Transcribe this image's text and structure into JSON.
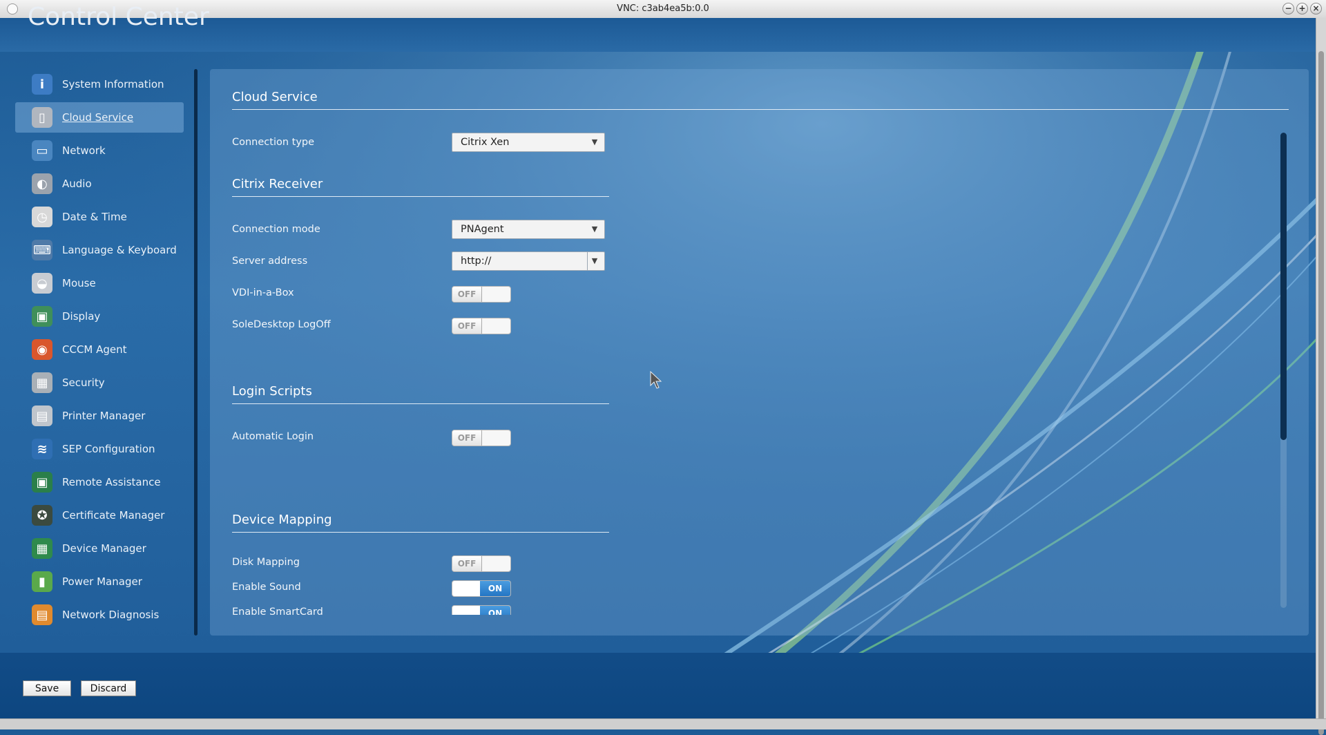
{
  "window": {
    "title": "VNC: c3ab4ea5b:0.0",
    "controls": [
      "minimize-icon",
      "maximize-icon",
      "close-icon"
    ]
  },
  "app": {
    "title": "Control Center"
  },
  "sidebar": {
    "items": [
      {
        "label": "System Information",
        "icon": "info-icon",
        "active": false
      },
      {
        "label": "Cloud Service",
        "icon": "cloud-service-icon",
        "active": true
      },
      {
        "label": "Network",
        "icon": "network-icon",
        "active": false
      },
      {
        "label": "Audio",
        "icon": "speaker-icon",
        "active": false
      },
      {
        "label": "Date & Time",
        "icon": "clock-icon",
        "active": false
      },
      {
        "label": "Language & Keyboard",
        "icon": "keyboard-icon",
        "active": false
      },
      {
        "label": "Mouse",
        "icon": "mouse-icon",
        "active": false
      },
      {
        "label": "Display",
        "icon": "monitor-icon",
        "active": false
      },
      {
        "label": "CCCM Agent",
        "icon": "cccm-agent-icon",
        "active": false
      },
      {
        "label": "Security",
        "icon": "security-icon",
        "active": false
      },
      {
        "label": "Printer Manager",
        "icon": "printer-icon",
        "active": false
      },
      {
        "label": "SEP Configuration",
        "icon": "sep-icon",
        "active": false
      },
      {
        "label": "Remote Assistance",
        "icon": "remote-assistance-icon",
        "active": false
      },
      {
        "label": "Certificate Manager",
        "icon": "certificate-icon",
        "active": false
      },
      {
        "label": "Device Manager",
        "icon": "device-manager-icon",
        "active": false
      },
      {
        "label": "Power Manager",
        "icon": "battery-icon",
        "active": false
      },
      {
        "label": "Network Diagnosis",
        "icon": "network-diagnosis-icon",
        "active": false
      }
    ]
  },
  "main": {
    "section_title": "Cloud Service",
    "connection_type": {
      "label": "Connection type",
      "value": "Citrix Xen"
    },
    "citrix_receiver": {
      "title": "Citrix Receiver",
      "connection_mode": {
        "label": "Connection mode",
        "value": "PNAgent"
      },
      "server_address": {
        "label": "Server address",
        "value": "http://"
      },
      "vdi_in_a_box": {
        "label": "VDI-in-a-Box",
        "state": "OFF"
      },
      "soledesktop_logoff": {
        "label": "SoleDesktop LogOff",
        "state": "OFF"
      }
    },
    "login_scripts": {
      "title": "Login Scripts",
      "automatic_login": {
        "label": "Automatic Login",
        "state": "OFF"
      }
    },
    "device_mapping": {
      "title": "Device Mapping",
      "disk_mapping": {
        "label": "Disk Mapping",
        "state": "OFF"
      },
      "enable_sound": {
        "label": "Enable Sound",
        "state": "ON"
      },
      "enable_smartcard": {
        "label": "Enable SmartCard",
        "state": "ON"
      }
    }
  },
  "footer": {
    "save_label": "Save",
    "discard_label": "Discard"
  },
  "colors": {
    "background": "#1d5b95",
    "active_nav": "#6fa3d0",
    "toggle_on": "#2f86d4"
  }
}
